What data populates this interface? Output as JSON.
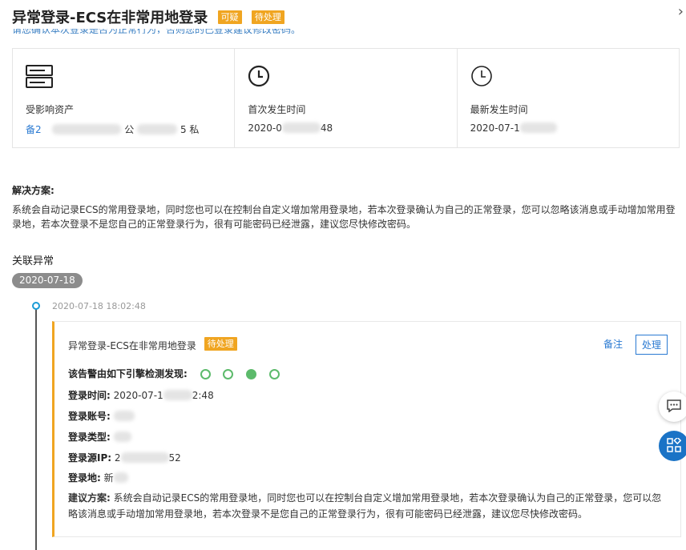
{
  "header": {
    "title": "异常登录-ECS在非常用地登录",
    "badge_suspicious": "可疑",
    "badge_pending": "待处理",
    "close_glyph": "›",
    "subtitle_partial": "请您确认本次登录是否为正常行为，否则您的已登录建议修改密码。"
  },
  "cards": [
    {
      "label": "受影响资产",
      "value_prefix": "备2",
      "value_mid": "公",
      "value_suffix": "5 私",
      "icon": "server-icon"
    },
    {
      "label": "首次发生时间",
      "value_prefix": "2020-0",
      "value_suffix": "48",
      "icon": "clock-icon"
    },
    {
      "label": "最新发生时间",
      "value_prefix": "2020-07-1",
      "icon": "clock-icon"
    }
  ],
  "solution": {
    "title": "解决方案:",
    "text": "系统会自动记录ECS的常用登录地，同时您也可以在控制台自定义增加常用登录地，若本次登录确认为自己的正常登录，您可以忽略该消息或手动增加常用登录地，若本次登录不是您自己的正常登录行为，很有可能密码已经泄露，建议您尽快修改密码。"
  },
  "related": {
    "title": "关联异常",
    "date": "2020-07-18",
    "event_time": "2020-07-18 18:02:48"
  },
  "alert": {
    "title": "异常登录-ECS在非常用地登录",
    "badge": "待处理",
    "note_label": "备注",
    "handle_label": "处理",
    "engines_label": "该告警由如下引擎检测发现:",
    "login_time_label": "登录时间:",
    "login_time_prefix": "2020-07-1",
    "login_time_suffix": "2:48",
    "account_label": "登录账号:",
    "type_label": "登录类型:",
    "source_ip_label": "登录源IP:",
    "source_ip_prefix": "2",
    "source_ip_suffix": "52",
    "location_label": "登录地:",
    "location_prefix": "新",
    "advice_label": "建议方案:",
    "advice_text": "系统会自动记录ECS的常用登录地，同时您也可以在控制台自定义增加常用登录地，若本次登录确认为自己的正常登录，您可以忽略该消息或手动增加常用登录地，若本次登录不是您自己的正常登录行为，很有可能密码已经泄露，建议您尽快修改密码。"
  },
  "colors": {
    "accent": "#f0a521",
    "link": "#2a7ad2",
    "engine": "#5cba6b",
    "timeline_dot": "#1a9cd6"
  }
}
